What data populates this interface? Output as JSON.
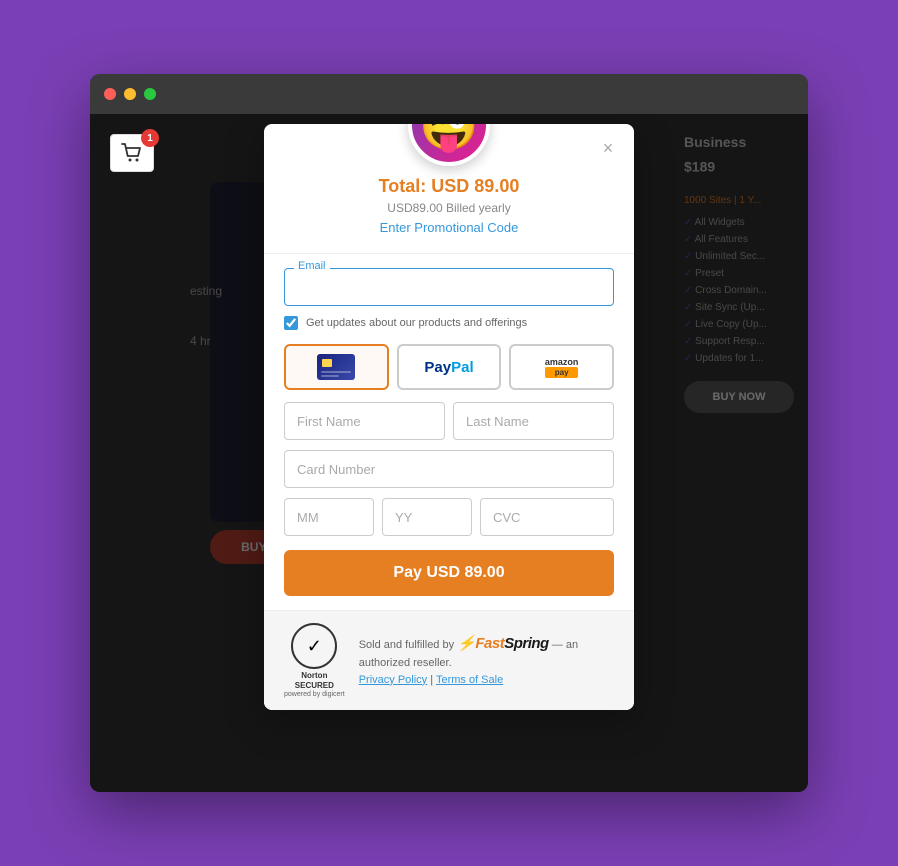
{
  "browser": {
    "dots": [
      "red",
      "yellow",
      "green"
    ]
  },
  "cart": {
    "badge": "1",
    "icon": "🛒"
  },
  "modal": {
    "close_label": "×",
    "avatar_emoji": "😜",
    "total_label": "Total: USD 89.00",
    "billed_text": "USD89.00 Billed yearly",
    "promo_link": "Enter Promotional Code",
    "email_field_label": "Email",
    "email_placeholder": "",
    "checkbox_label": "Get updates about our products and offerings",
    "payment_tabs": [
      {
        "id": "card",
        "label": "Credit Card",
        "active": true
      },
      {
        "id": "paypal",
        "label": "PayPal",
        "active": false
      },
      {
        "id": "amazon",
        "label": "Amazon Pay",
        "active": false
      }
    ],
    "first_name_placeholder": "First Name",
    "last_name_placeholder": "Last Name",
    "card_number_placeholder": "Card Number",
    "mm_placeholder": "MM",
    "yy_placeholder": "YY",
    "cvc_placeholder": "CVC",
    "pay_button_label": "Pay USD 89.00"
  },
  "footer": {
    "norton_line1": "Norton",
    "norton_line2": "SECURED",
    "norton_sub": "powered by digicert",
    "fastspring_text": "Sold and fulfilled by",
    "fastspring_brand": "FastSpring",
    "fastspring_suffix": "— an authorized reseller.",
    "privacy_policy": "Privacy Policy",
    "separator": "|",
    "terms": "Terms of Sale"
  },
  "background": {
    "title": "Business",
    "price_symbol": "$",
    "price": "189",
    "subtitle": "1000 Sites | 1 Y...",
    "features": [
      "All Widgets",
      "All Features",
      "Unlimited Sec...",
      "Preset",
      "Cross Domain...",
      "Site Sync (Up...",
      "Live Copy (Up...",
      "Support Resp...",
      "Updates for 1..."
    ],
    "buy_now": "BUY NOW",
    "testing_label": "esting",
    "time_label": "4 hr"
  }
}
